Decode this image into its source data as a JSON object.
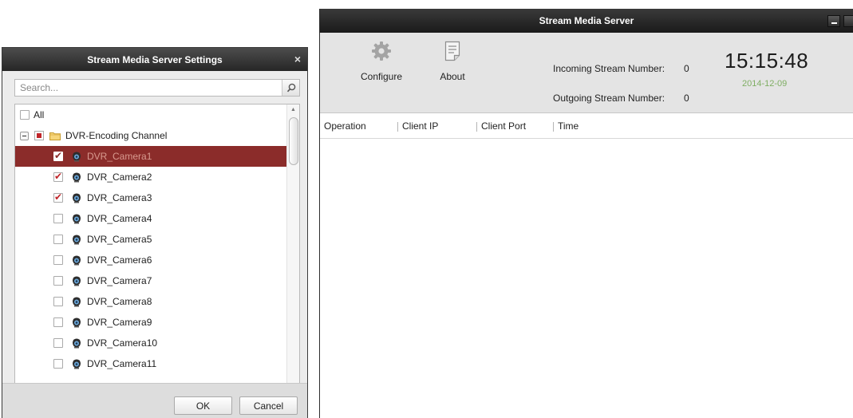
{
  "dialog": {
    "title": "Stream Media Server Settings",
    "close_glyph": "×",
    "search_placeholder": "Search...",
    "all_label": "All",
    "group_label": "DVR-Encoding Channel",
    "cameras": [
      {
        "name": "DVR_Camera1",
        "checked": true,
        "selected": true
      },
      {
        "name": "DVR_Camera2",
        "checked": true,
        "selected": false
      },
      {
        "name": "DVR_Camera3",
        "checked": true,
        "selected": false
      },
      {
        "name": "DVR_Camera4",
        "checked": false,
        "selected": false
      },
      {
        "name": "DVR_Camera5",
        "checked": false,
        "selected": false
      },
      {
        "name": "DVR_Camera6",
        "checked": false,
        "selected": false
      },
      {
        "name": "DVR_Camera7",
        "checked": false,
        "selected": false
      },
      {
        "name": "DVR_Camera8",
        "checked": false,
        "selected": false
      },
      {
        "name": "DVR_Camera9",
        "checked": false,
        "selected": false
      },
      {
        "name": "DVR_Camera10",
        "checked": false,
        "selected": false
      },
      {
        "name": "DVR_Camera11",
        "checked": false,
        "selected": false
      }
    ],
    "ok_label": "OK",
    "cancel_label": "Cancel"
  },
  "main": {
    "title": "Stream Media Server",
    "configure_label": "Configure",
    "about_label": "About",
    "incoming_label": "Incoming Stream Number:",
    "incoming_value": "0",
    "outgoing_label": "Outgoing Stream Number:",
    "outgoing_value": "0",
    "time": "15:15:48",
    "date": "2014-12-09",
    "columns": [
      "Operation",
      "Client IP",
      "Client Port",
      "Time"
    ]
  },
  "colors": {
    "selected_row": "#8b2c2a",
    "check_mark": "#c0252a",
    "date_text": "#7fae63"
  }
}
